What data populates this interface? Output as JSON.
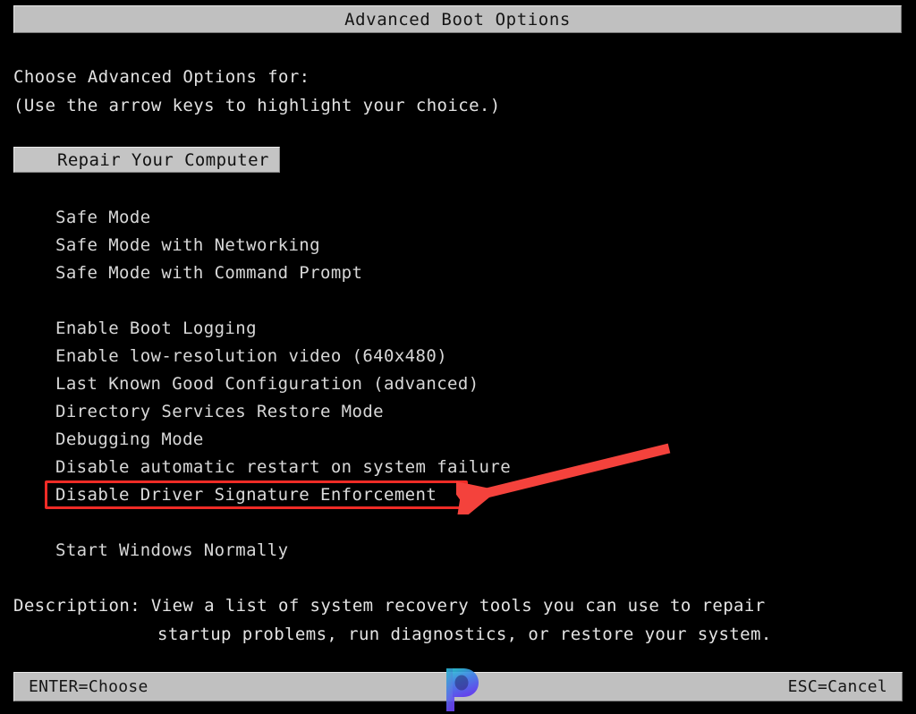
{
  "window": {
    "title": "Advanced Boot Options"
  },
  "prompt": {
    "line1": "Choose Advanced Options for:",
    "line2": "(Use the arrow keys to highlight your choice.)"
  },
  "selected_option": {
    "label": "Repair Your Computer",
    "state": "highlighted"
  },
  "menu": {
    "groups": [
      {
        "items": [
          {
            "label": "Safe Mode"
          },
          {
            "label": "Safe Mode with Networking"
          },
          {
            "label": "Safe Mode with Command Prompt"
          }
        ]
      },
      {
        "items": [
          {
            "label": "Enable Boot Logging"
          },
          {
            "label": "Enable low-resolution video (640x480)"
          },
          {
            "label": "Last Known Good Configuration (advanced)"
          },
          {
            "label": "Directory Services Restore Mode"
          },
          {
            "label": "Debugging Mode"
          },
          {
            "label": "Disable automatic restart on system failure"
          },
          {
            "label": "Disable Driver Signature Enforcement"
          }
        ]
      },
      {
        "items": [
          {
            "label": "Start Windows Normally"
          }
        ]
      }
    ]
  },
  "annotation": {
    "target_label": "Disable Driver Signature Enforcement",
    "box_color": "#ef2b26",
    "arrow_color": "#f4423c"
  },
  "description": {
    "line1": "Description: View a list of system recovery tools you can use to repair",
    "line2": "startup problems, run diagnostics, or restore your system."
  },
  "status_bar": {
    "left": "ENTER=Choose",
    "right": "ESC=Cancel"
  },
  "watermark": {
    "icon": "letter-p-logo",
    "gradient_top": "#2ec7d6",
    "gradient_bottom": "#5c3bf0"
  },
  "colors": {
    "background": "#000000",
    "bar_background": "#c0c0c0",
    "bar_text": "#151515",
    "terminal_text": "#dcdcdc",
    "accent_red": "#ef2b26"
  }
}
